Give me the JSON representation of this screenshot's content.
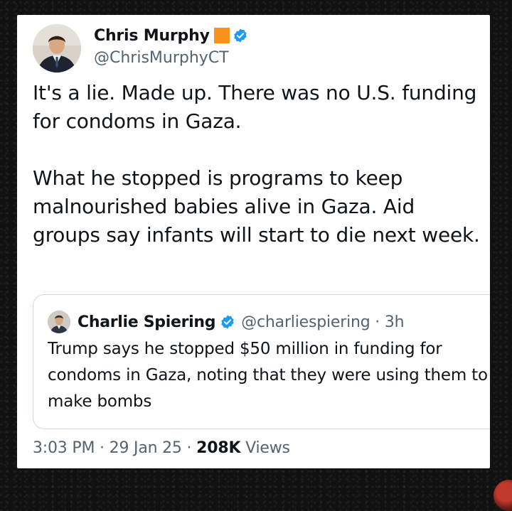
{
  "tweet": {
    "author": {
      "display_name": "Chris Murphy",
      "handle": "@ChrisMurphyCT"
    },
    "paragraphs": [
      "It's a lie. Made up. There was no U.S. funding for condoms in Gaza.",
      "What he stopped is programs to keep malnourished babies alive in Gaza. Aid groups say infants will start to die next week."
    ],
    "quote": {
      "author_name": "Charlie Spiering",
      "handle_time": "@charliespiering · 3h",
      "text": "Trump says he stopped $50 million in funding for condoms in Gaza, noting that they were using them to make bombs"
    },
    "meta": {
      "time": "3:03 PM",
      "date": "29 Jan 25",
      "views_count": "208K",
      "views_label": "Views",
      "separator": "·"
    }
  },
  "icons": {
    "verified": "verified-badge-icon",
    "emoji": "orange-square-emoji"
  },
  "colors": {
    "verified_blue": "#1d9bf0",
    "orange_square": "#f7931a",
    "text_primary": "#0f1419",
    "text_secondary": "#536471"
  }
}
